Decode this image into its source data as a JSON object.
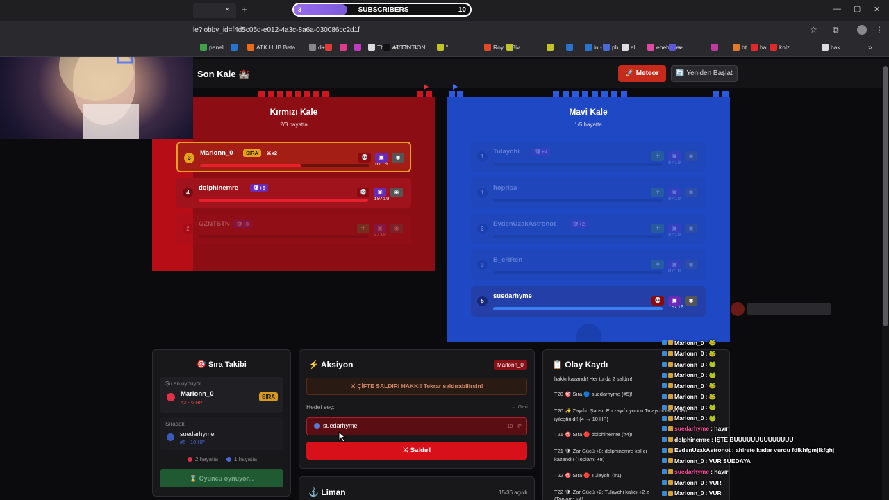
{
  "browser": {
    "url": "le?lobby_id=f4d5c05d-e012-4a3c-8a6a-030086cc2d1f",
    "tab_close": "×",
    "new_tab": "+",
    "window_controls": [
      "—",
      "▢",
      "✕"
    ],
    "bookmarks": [
      "panel",
      "",
      "ATK HUB Beta",
      "d+",
      "",
      "",
      "",
      "The Last Of Us",
      "ATTENTION",
      "\"",
      "Roy G Biv",
      "",
      "",
      "",
      "in -",
      "pb",
      "al",
      "ehehehee",
      "s",
      "",
      "bt",
      "ha",
      "knlz",
      "bak"
    ],
    "bookmark_colors": [
      "#3fa34a",
      "#2a72d0",
      "#e86a1a",
      "#888",
      "#e03a3a",
      "#e03a8a",
      "#c23ac2",
      "#dcdcdc",
      "#111",
      "#c2c22a",
      "#e04a2a",
      "#c2c22a",
      "#c2c22a",
      "#2a72d0",
      "#2a72d0",
      "#4a6ad8",
      "#ddd",
      "#e04aa0",
      "#5a5ad8",
      "#c23aa0",
      "#e07a2a",
      "#e02a2a",
      "#e02a2a",
      "#ddd"
    ]
  },
  "subscribers": {
    "current": "3",
    "label": "SUBSCRIBERS",
    "goal": "10",
    "progress_fraction": 0.3
  },
  "app": {
    "title": "Son Kale 🏰",
    "meteor_button": "🚀 Meteor",
    "restart_button": "🔄 Yeniden Başlat"
  },
  "red_castle": {
    "title": "Kırmızı Kale",
    "alive": "2/3 hayatta",
    "players": [
      {
        "num": "3",
        "name": "Marlonn_0",
        "tag": "SIRA",
        "extra": "⚔x2",
        "hp": "6/10",
        "hp_fraction": 0.6,
        "active": true
      },
      {
        "num": "4",
        "name": "dolphinemre",
        "extra": "🛡+8",
        "hp": "10/10",
        "hp_fraction": 1.0
      },
      {
        "num": "2",
        "name": "OZNTSTN",
        "extra": "🛡+8",
        "hp": "0/10",
        "hp_fraction": 0,
        "dead": true
      }
    ]
  },
  "blue_castle": {
    "title": "Mavi Kale",
    "alive": "1/5 hayatta",
    "players": [
      {
        "num": "1",
        "name": "Tulaychi",
        "extra": "🛡+4",
        "hp": "0/10",
        "hp_fraction": 0,
        "dead": true
      },
      {
        "num": "1",
        "name": "hoprisa",
        "extra": "",
        "hp": "0/10",
        "hp_fraction": 0,
        "dead": true
      },
      {
        "num": "2",
        "name": "EvdenUzakAstronot",
        "extra": "🛡+2",
        "hp": "0/10",
        "hp_fraction": 0,
        "dead": true
      },
      {
        "num": "3",
        "name": "B_eRRen",
        "extra": "",
        "hp": "0/10",
        "hp_fraction": 0,
        "dead": true
      },
      {
        "num": "5",
        "name": "suedarhyme",
        "extra": "",
        "hp": "10/10",
        "hp_fraction": 1.0
      }
    ]
  },
  "turn_panel": {
    "title": "🎯 Sıra Takibi",
    "now_label": "Şu an oynuyor",
    "now_name": "Marlonn_0",
    "now_meta": "#3 - 6 HP",
    "now_tag": "SIRA",
    "next_label": "Sıradaki",
    "next_name": "suedarhyme",
    "next_meta": "#5 - 10 HP",
    "red_alive": "2 hayatta",
    "blue_alive": "1 hayatta",
    "status_button": "⌛ Oyuncu oynuyor..."
  },
  "action_panel": {
    "title": "⚡ Aksiyon",
    "player_badge": "Marlonn_0",
    "double_attack": "⚔ ÇİFTE SALDIRI HAKKI! Tekrar saldırabilirsin!",
    "target_label": "Hedef seç:",
    "back": "← Geri",
    "target_name": "suedarhyme",
    "target_hp": "10 HP",
    "attack_button": "⚔ Saldır!"
  },
  "harbor_panel": {
    "title": "⚓ Liman",
    "count": "15/36 açıldı"
  },
  "log_panel": {
    "title": "📋 Olay Kaydı",
    "events": [
      "hakkı kazandı! Her turda 2 saldırı!",
      "T20 🎯 Sıra 🔵 suedarhyme (#5)!",
      "T20 ✨ Zayıfın Şansı: En zayıf oyuncu Tulaychi tamamen",
      "iyileştirildi! (4 → 10 HP)",
      "T21 🎯 Sıra 🔴 dolphinemre (#4)!",
      "T21 🛡 Zar Gücü +8: dolphinemre kalıcı",
      "kazandı! (Toplam: +8)",
      "T22 🎯 Sıra 🔴 Tulaychi (#1)!",
      "T22 🛡 Zar Gücü +2: Tulaychi kalıcı +2 z",
      "(Toplam: +4)"
    ]
  },
  "chat": [
    {
      "user": "Marlonn_0",
      "msg": ": 🐸",
      "color": "#ffffff"
    },
    {
      "user": "Marlonn_0",
      "msg": ": 🐸",
      "color": "#ffffff"
    },
    {
      "user": "Marlonn_0",
      "msg": ": 🐸",
      "color": "#ffffff"
    },
    {
      "user": "Marlonn_0",
      "msg": ": 🐸",
      "color": "#ffffff"
    },
    {
      "user": "Marlonn_0",
      "msg": ": 🐸",
      "color": "#ffffff"
    },
    {
      "user": "Marlonn_0",
      "msg": ": 🐸",
      "color": "#ffffff"
    },
    {
      "user": "Marlonn_0",
      "msg": ": 🐸",
      "color": "#ffffff"
    },
    {
      "user": "Marlonn_0",
      "msg": ": 🐸",
      "color": "#ffffff"
    },
    {
      "user": "suedarhyme",
      "msg": ": hayır",
      "color": "#ff4aa0"
    },
    {
      "user": "dolphinemre",
      "msg": ": İŞTE BUUUUUUUUUUUUUU",
      "color": "#ffffff"
    },
    {
      "user": "EvdenUzakAstronot",
      "msg": ": ahirete kadar vurdu fdlkhfgmjlkfghj",
      "color": "#ffffff"
    },
    {
      "user": "Marlonn_0",
      "msg": ": VUR SUEDAYA",
      "color": "#ffffff"
    },
    {
      "user": "suedarhyme",
      "msg": ": hayır",
      "color": "#ff4aa0"
    },
    {
      "user": "Marlonn_0",
      "msg": ": VUR",
      "color": "#ffffff"
    },
    {
      "user": "Marlonn_0",
      "msg": ": VUR",
      "color": "#ffffff"
    }
  ],
  "icons": {
    "skull": "💀",
    "box": "▣",
    "dice": "◉",
    "heal": "✚"
  }
}
